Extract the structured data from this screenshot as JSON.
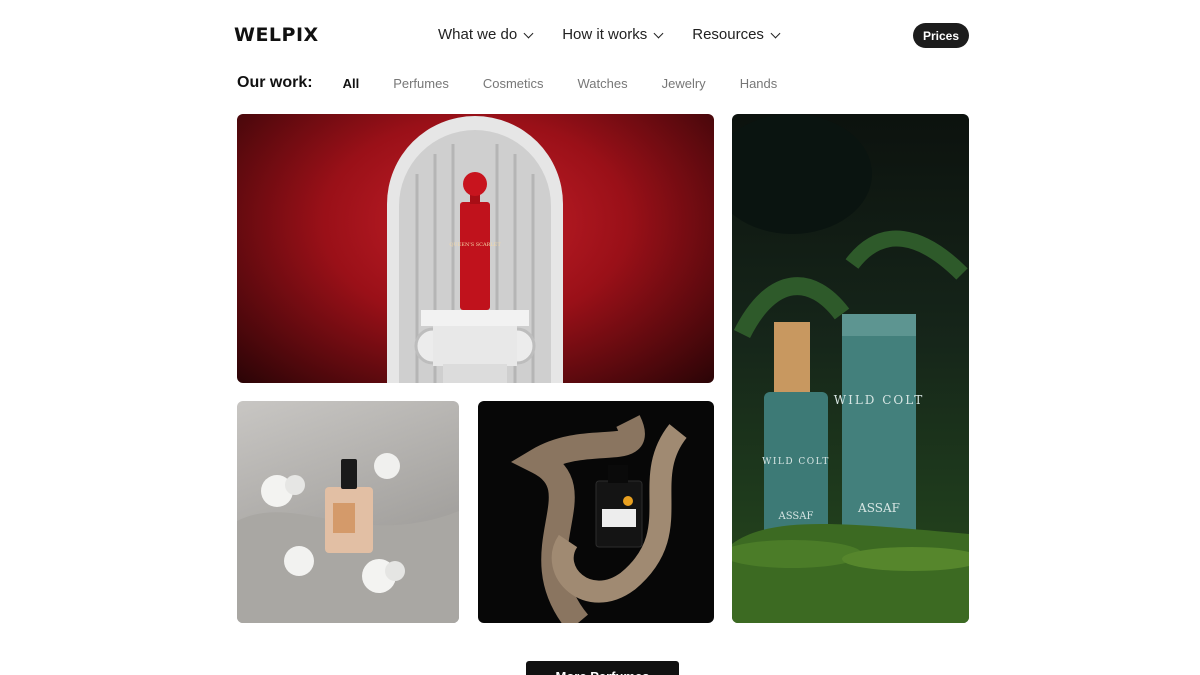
{
  "header": {
    "logo": "WELPIX",
    "nav": [
      {
        "label": "What we do"
      },
      {
        "label": "How it works"
      },
      {
        "label": "Resources"
      }
    ],
    "cta_label": "Prices"
  },
  "filters": {
    "label": "Our work:",
    "items": [
      "All",
      "Perfumes",
      "Cosmetics",
      "Watches",
      "Jewelry",
      "Hands"
    ],
    "active": "All"
  },
  "gallery": {
    "tile1": {
      "bottle_text": "QUEEN'S SCARLET",
      "color": "#c8202a"
    },
    "tile2": {
      "color": "#d9b89a"
    },
    "tile3": {
      "label_text": "EAU DE PARFUM",
      "color": "#e8a020"
    },
    "tile4": {
      "brand": "ASSAF",
      "product": "WILD COLT",
      "color": "#3f7a78"
    }
  },
  "more_button": "More Perfumes"
}
